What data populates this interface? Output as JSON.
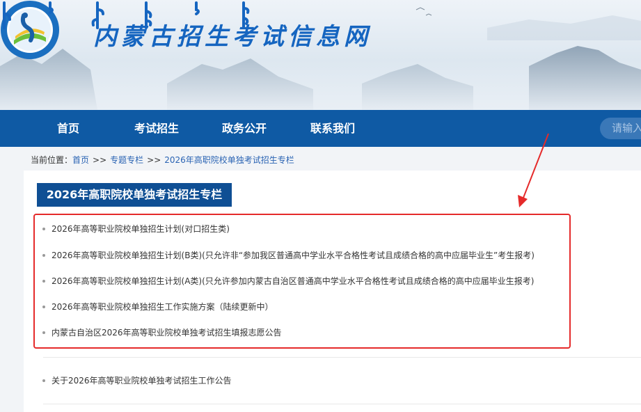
{
  "header": {
    "site_title": "内蒙古招生考试信息网"
  },
  "nav": {
    "items": [
      {
        "label": "首页"
      },
      {
        "label": "考试招生"
      },
      {
        "label": "政务公开"
      },
      {
        "label": "联系我们"
      }
    ],
    "search_placeholder": "请输入"
  },
  "breadcrumb": {
    "prefix": "当前位置：",
    "home": "首页",
    "separator": ">>",
    "section": "专题专栏",
    "current": "2026年高职院校单独考试招生专栏"
  },
  "main": {
    "section_title": "2026年高职院校单独考试招生专栏",
    "highlighted_items": [
      "2026年高等职业院校单独招生计划(对口招生类)",
      "2026年高等职业院校单独招生计划(B类)(只允许非“参加我区普通高中学业水平合格性考试且成绩合格的高中应届毕业生”考生报考)",
      "2026年高等职业院校单独招生计划(A类)(只允许参加内蒙古自治区普通高中学业水平合格性考试且成绩合格的高中应届毕业生报考)",
      "2026年高等职业院校单独招生工作实施方案（陆续更新中）",
      "内蒙古自治区2026年高等职业院校单独考试招生填报志愿公告"
    ],
    "other_items": [
      "关于2026年高等职业院校单独考试招生工作公告"
    ]
  },
  "colors": {
    "nav_bg": "#0f5aa4",
    "title_bg": "#0f4f94",
    "highlight": "#e52a2a",
    "link": "#2a63b3"
  }
}
